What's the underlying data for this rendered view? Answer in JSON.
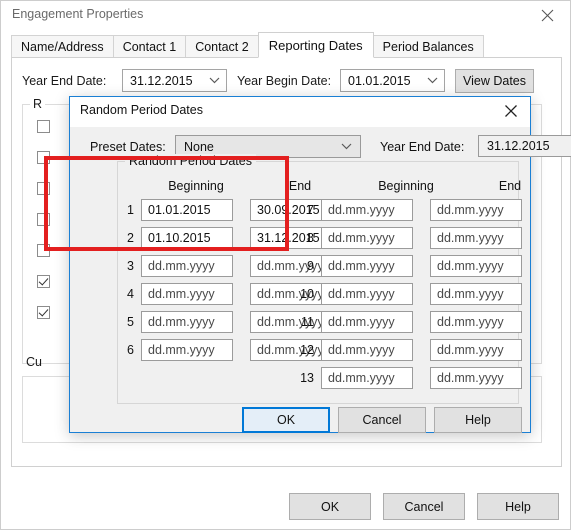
{
  "window": {
    "title": "Engagement Properties",
    "close_icon": "close-icon"
  },
  "tabs": [
    {
      "label": "Name/Address",
      "active": false
    },
    {
      "label": "Contact 1",
      "active": false
    },
    {
      "label": "Contact 2",
      "active": false
    },
    {
      "label": "Reporting Dates",
      "active": true
    },
    {
      "label": "Period Balances",
      "active": false
    }
  ],
  "main": {
    "year_end_label": "Year End Date:",
    "year_end_value": "31.12.2015",
    "year_begin_label": "Year Begin Date:",
    "year_begin_value": "01.01.2015",
    "view_dates_label": "View Dates",
    "group_title_partial": "R",
    "cu_label": "Cu",
    "buttons": {
      "ok": "OK",
      "cancel": "Cancel",
      "help": "Help"
    }
  },
  "dialog": {
    "title": "Random Period Dates",
    "close_icon": "close-icon",
    "preset_label": "Preset Dates:",
    "preset_value": "None",
    "year_end_label": "Year End Date:",
    "year_end_value": "31.12.2015",
    "group_title": "Random Period Dates",
    "col_beginning": "Beginning",
    "col_end": "End",
    "placeholder": "dd.mm.yyyy",
    "rows_left": [
      {
        "num": "1",
        "beginning": "01.01.2015",
        "end": "30.09.2015"
      },
      {
        "num": "2",
        "beginning": "01.10.2015",
        "end": "31.12.2015"
      },
      {
        "num": "3",
        "beginning": "dd.mm.yyyy",
        "end": "dd.mm.yyyy"
      },
      {
        "num": "4",
        "beginning": "dd.mm.yyyy",
        "end": "dd.mm.yyyy"
      },
      {
        "num": "5",
        "beginning": "dd.mm.yyyy",
        "end": "dd.mm.yyyy"
      },
      {
        "num": "6",
        "beginning": "dd.mm.yyyy",
        "end": "dd.mm.yyyy"
      }
    ],
    "rows_right": [
      {
        "num": "7",
        "beginning": "dd.mm.yyyy",
        "end": "dd.mm.yyyy"
      },
      {
        "num": "8",
        "beginning": "dd.mm.yyyy",
        "end": "dd.mm.yyyy"
      },
      {
        "num": "9",
        "beginning": "dd.mm.yyyy",
        "end": "dd.mm.yyyy"
      },
      {
        "num": "10",
        "beginning": "dd.mm.yyyy",
        "end": "dd.mm.yyyy"
      },
      {
        "num": "11",
        "beginning": "dd.mm.yyyy",
        "end": "dd.mm.yyyy"
      },
      {
        "num": "12",
        "beginning": "dd.mm.yyyy",
        "end": "dd.mm.yyyy"
      },
      {
        "num": "13",
        "beginning": "dd.mm.yyyy",
        "end": "dd.mm.yyyy"
      }
    ],
    "buttons": {
      "ok": "OK",
      "cancel": "Cancel",
      "help": "Help"
    }
  },
  "colors": {
    "highlight_red": "#e31f1f",
    "focus_blue": "#0078d7",
    "dialog_border": "#1a7fd4"
  }
}
